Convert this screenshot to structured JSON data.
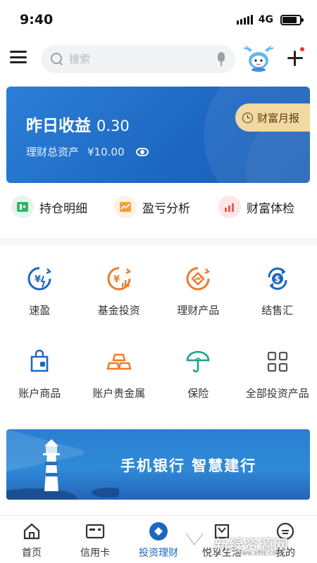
{
  "status_bar": {
    "time": "9:40",
    "network": "4G",
    "battery_level": 0.85
  },
  "search": {
    "placeholder": "搜索"
  },
  "asset_card": {
    "yield_label": "昨日收益",
    "yield_value": "0.30",
    "total_label": "理财总资产",
    "total_value": "¥10.00",
    "monthly_report": "财富月报"
  },
  "quick_actions": [
    {
      "label": "持仓明细",
      "icon": "wallet-icon",
      "color": "#2fb56a"
    },
    {
      "label": "盈亏分析",
      "icon": "chart-icon",
      "color": "#f0a33a"
    },
    {
      "label": "财富体检",
      "icon": "bar-chart-icon",
      "color": "#e85a5a"
    }
  ],
  "grid": [
    {
      "label": "速盈",
      "icon": "quick-profit-icon",
      "color": "#1d67c2"
    },
    {
      "label": "基金投资",
      "icon": "fund-icon",
      "color": "#f07a2a"
    },
    {
      "label": "理财产品",
      "icon": "finance-product-icon",
      "color": "#f07a2a"
    },
    {
      "label": "结售汇",
      "icon": "exchange-icon",
      "color": "#1d67c2"
    },
    {
      "label": "账户商品",
      "icon": "bag-icon",
      "color": "#1d67c2"
    },
    {
      "label": "账户贵金属",
      "icon": "gold-bars-icon",
      "color": "#f07a2a"
    },
    {
      "label": "保险",
      "icon": "umbrella-icon",
      "color": "#1aa38a"
    },
    {
      "label": "全部投资产品",
      "icon": "all-products-icon",
      "color": "#555555"
    }
  ],
  "banner": {
    "text": "手机银行  智慧建行"
  },
  "bottom_nav": [
    {
      "label": "首页",
      "icon": "home-icon"
    },
    {
      "label": "信用卡",
      "icon": "credit-card-icon"
    },
    {
      "label": "投资理财",
      "icon": "invest-icon",
      "active": true
    },
    {
      "label": "悦享生活",
      "icon": "life-icon"
    },
    {
      "label": "我的",
      "icon": "profile-icon"
    }
  ],
  "watermark": {
    "text": "新绿资源网",
    "url": "www.xlhs.com"
  }
}
